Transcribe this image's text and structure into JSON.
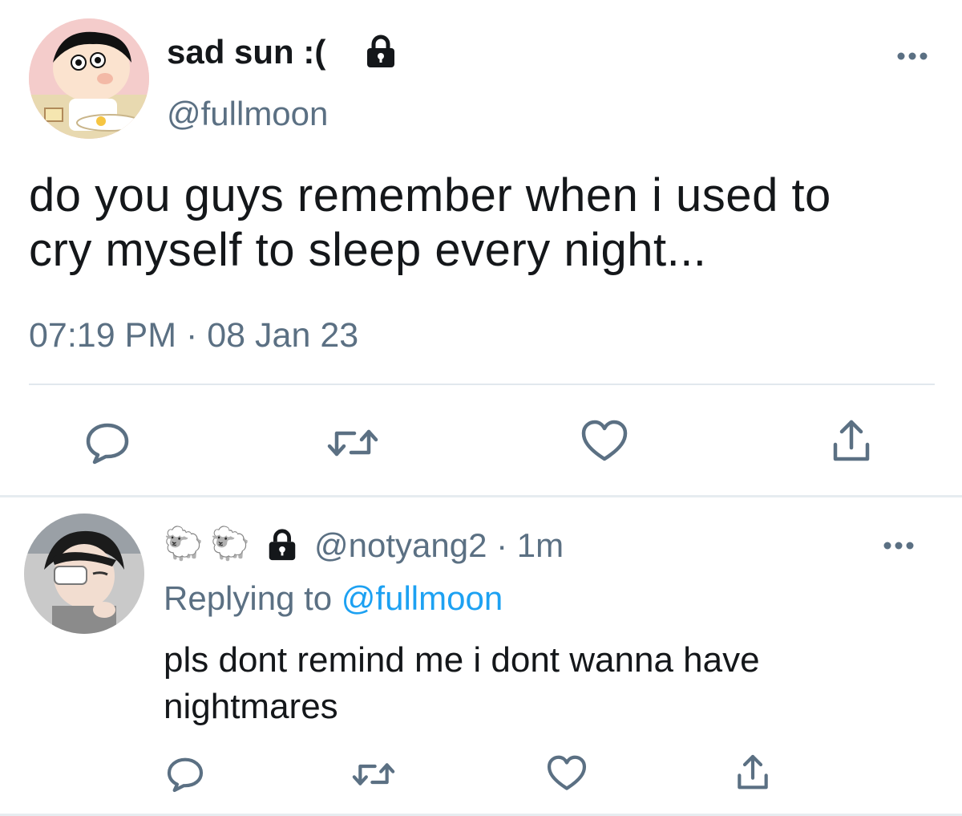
{
  "main_tweet": {
    "display_name": "sad sun :(",
    "handle": "@fullmoon",
    "text": "do you guys remember when i used to\ncry myself to sleep every night...",
    "timestamp": "07:19 PM · 08 Jan 23",
    "icons": [
      "lock-icon",
      "more-icon",
      "reply-icon",
      "retweet-icon",
      "like-icon",
      "share-icon"
    ]
  },
  "reply_tweet": {
    "name_emojis": [
      "🐑",
      "🐑"
    ],
    "handle_time": "@notyang2 · 1m",
    "replying_prefix": "Replying to ",
    "replying_mention": "@fullmoon",
    "text": "pls dont remind me i dont wanna have nightmares",
    "icons": [
      "lock-icon",
      "more-icon",
      "reply-icon",
      "retweet-icon",
      "like-icon",
      "share-icon"
    ]
  },
  "colors": {
    "text": "#14171a",
    "secondary": "#5b7083",
    "link": "#1da1f2",
    "divider": "#e1e8ed"
  }
}
